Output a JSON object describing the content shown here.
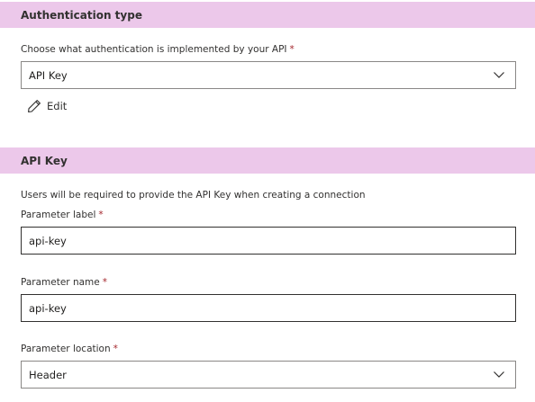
{
  "auth_section": {
    "title": "Authentication type",
    "prompt_label": "Choose what authentication is implemented by your API",
    "required_marker": "*",
    "selected_value": "API Key",
    "edit_label": "Edit"
  },
  "api_key_section": {
    "title": "API Key",
    "description": "Users will be required to provide the API Key when creating a connection",
    "parameter_label": {
      "label": "Parameter label",
      "required_marker": "*",
      "value": "api-key"
    },
    "parameter_name": {
      "label": "Parameter name",
      "required_marker": "*",
      "value": "api-key"
    },
    "parameter_location": {
      "label": "Parameter location",
      "required_marker": "*",
      "selected_value": "Header"
    }
  },
  "icons": {
    "dropdown": "chevron-down-icon",
    "edit": "pencil-icon"
  },
  "colors": {
    "section_header_bg": "#ecc8ea",
    "required": "#a4262c",
    "border": "#8a8886",
    "text": "#323130"
  }
}
